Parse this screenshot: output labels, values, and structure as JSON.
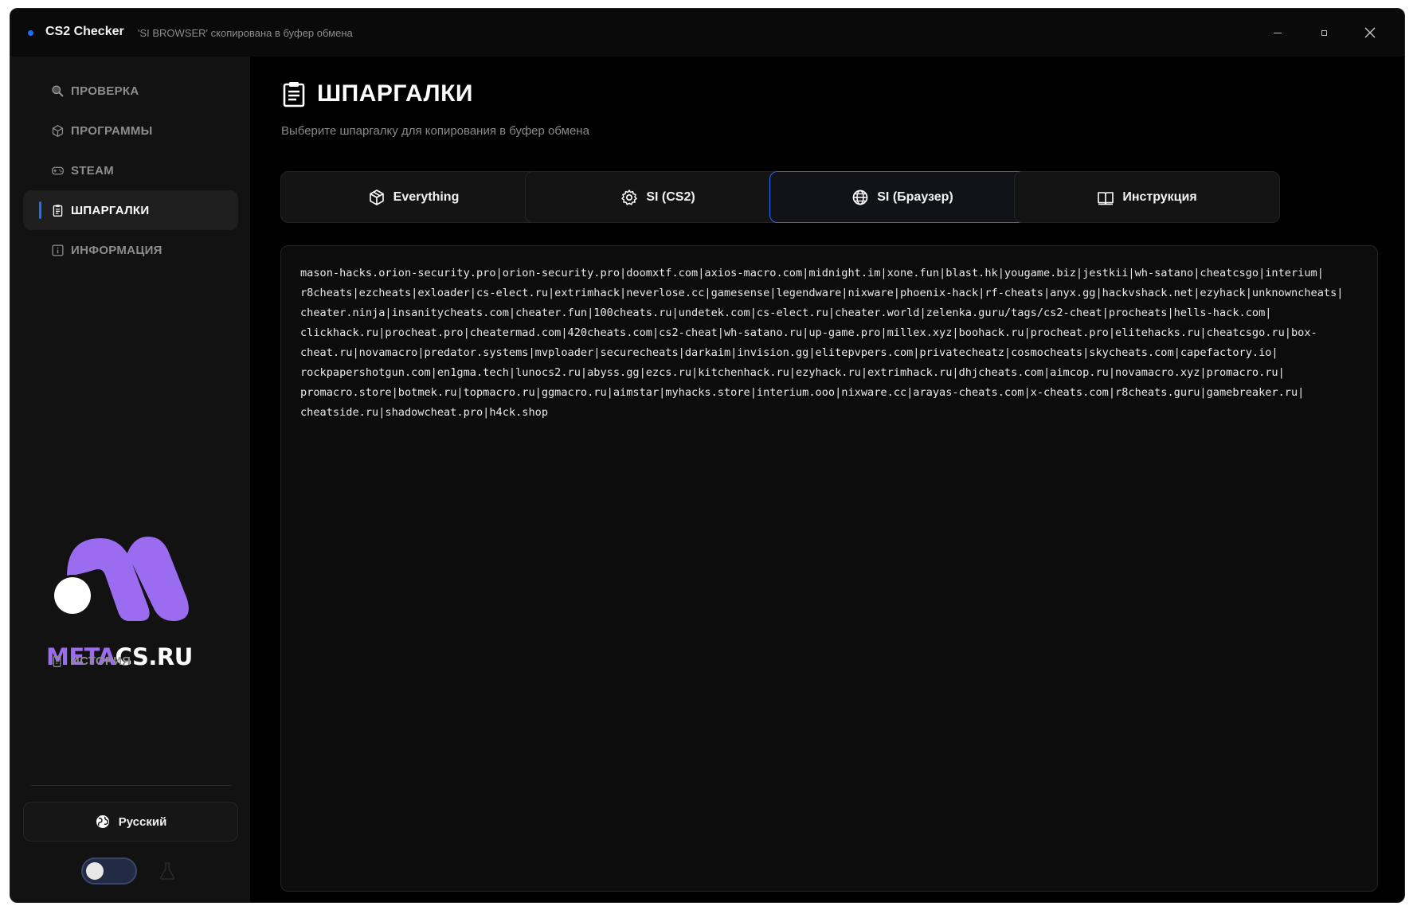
{
  "window": {
    "app_title": "CS2 Checker",
    "status_message": "'SI BROWSER' скопирована в буфер обмена",
    "accent_color": "#1e6bff"
  },
  "sidebar": {
    "items": [
      {
        "label": "ПРОВЕРКА",
        "icon": "search-icon"
      },
      {
        "label": "ПРОГРАММЫ",
        "icon": "package-icon"
      },
      {
        "label": "STEAM",
        "icon": "gamepad-icon"
      },
      {
        "label": "ШПАРГАЛКИ",
        "icon": "clipboard-icon",
        "active": true
      },
      {
        "label": "ИНФОРМАЦИЯ",
        "icon": "info-icon"
      }
    ],
    "logo": {
      "part1": "META",
      "part2": "CS.RU",
      "color": "#9b6cf0"
    },
    "history_label": "ИСТОРИЯ",
    "language_label": "Русский",
    "theme_toggle": false
  },
  "main": {
    "title": "ШПАРГАЛКИ",
    "subtitle": "Выберите шпаргалку для копирования в буфер обмена",
    "tabs": [
      {
        "label": "Everything",
        "icon": "cube-icon"
      },
      {
        "label": "SI (CS2)",
        "icon": "gear-icon"
      },
      {
        "label": "SI (Браузер)",
        "icon": "globe-icon",
        "active": true
      },
      {
        "label": "Инструкция",
        "icon": "book-icon"
      }
    ],
    "content": "mason-hacks.orion-security.pro|orion-security.pro|doomxtf.com|axios-macro.com|midnight.im|xone.fun|blast.hk|yougame.biz|jestkii|wh-satano|cheatcsgo|interium|\nr8cheats|ezcheats|exloader|cs-elect.ru|extrimhack|neverlose.cc|gamesense|legendware|nixware|phoenix-hack|rf-cheats|anyx.gg|hackvshack.net|ezyhack|unknowncheats|\ncheater.ninja|insanitycheats.com|cheater.fun|100cheats.ru|undetek.com|cs-elect.ru|cheater.world|zelenka.guru/tags/cs2-cheat|procheats|hells-hack.com|\nclickhack.ru|procheat.pro|cheatermad.com|420cheats.com|cs2-cheat|wh-satano.ru|up-game.pro|millex.xyz|boohack.ru|procheat.pro|elitehacks.ru|cheatcsgo.ru|box-\ncheat.ru|novamacro|predator.systems|mvploader|securecheats|darkaim|invision.gg|elitepvpers.com|privatecheatz|cosmocheats|skycheats.com|capefactory.io|\nrockpapershotgun.com|en1gma.tech|lunocs2.ru|abyss.gg|ezcs.ru|kitchenhack.ru|ezyhack.ru|extrimhack.ru|dhjcheats.com|aimcop.ru|novamacro.xyz|promacro.ru|\npromacro.store|botmek.ru|topmacro.ru|ggmacro.ru|aimstar|myhacks.store|interium.ooo|nixware.cc|arayas-cheats.com|x-cheats.com|r8cheats.guru|gamebreaker.ru|\ncheatside.ru|shadowcheat.pro|h4ck.shop"
  }
}
